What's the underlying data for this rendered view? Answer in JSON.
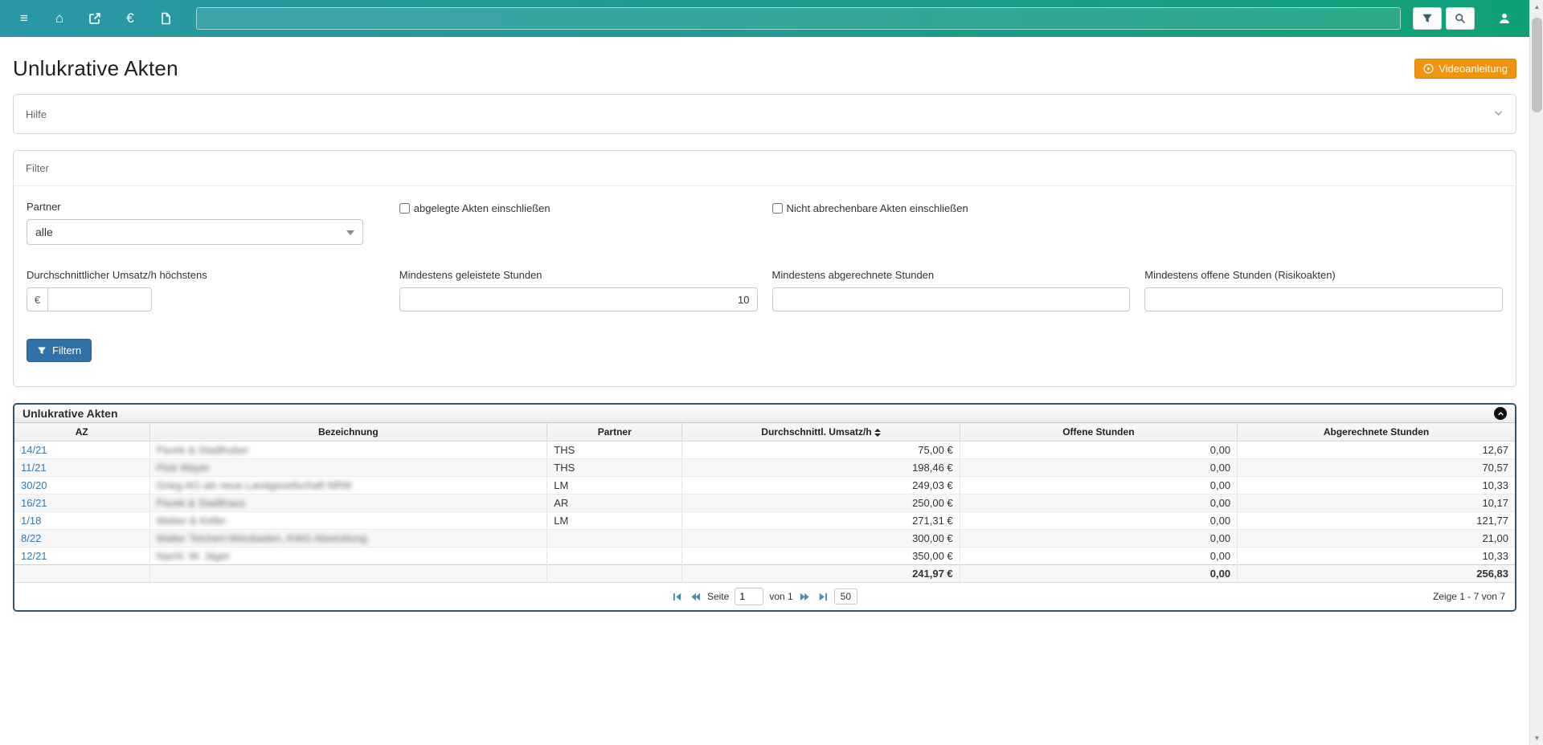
{
  "colors": {
    "navbar_start": "#2b97a6",
    "navbar_end": "#10a077",
    "accent_orange": "#f0930f",
    "accent_blue": "#3071a9",
    "link_blue": "#3079b5",
    "table_border": "#33536b"
  },
  "icons": [
    "menu-icon",
    "home-icon",
    "external-link-icon",
    "euro-icon",
    "file-icon",
    "filter-funnel-icon",
    "search-icon",
    "user-icon",
    "play-circle-icon",
    "chevron-down-icon",
    "collapse-up-icon",
    "sort-icon",
    "first-page-icon",
    "prev-page-icon",
    "next-page-icon",
    "last-page-icon",
    "scroll-up-icon",
    "scroll-down-icon"
  ],
  "navbar": {
    "menu_glyph": "≡",
    "home_glyph": "⌂",
    "euro_glyph": "€",
    "search_value": "",
    "search_placeholder": ""
  },
  "page": {
    "title": "Unlukrative Akten",
    "video_button_label": "Videoanleitung"
  },
  "help_panel": {
    "title": "Hilfe"
  },
  "filter": {
    "title": "Filter",
    "partner": {
      "label": "Partner",
      "value": "alle"
    },
    "checkboxes": [
      {
        "label": "abgelegte Akten einschließen",
        "checked": false
      },
      {
        "label": "Nicht abrechenbare Akten einschließen",
        "checked": false
      }
    ],
    "umsatz": {
      "label": "Durchschnittlicher Umsatz/h höchstens",
      "prefix": "€",
      "value": ""
    },
    "geleistet": {
      "label": "Mindestens geleistete Stunden",
      "value": "10"
    },
    "abgerechnet": {
      "label": "Mindestens abgerechnete Stunden",
      "value": ""
    },
    "offen": {
      "label": "Mindestens offene Stunden (Risikoakten)",
      "value": ""
    },
    "submit_label": "Filtern"
  },
  "table": {
    "title": "Unlukrative Akten",
    "columns": [
      "AZ",
      "Bezeichnung",
      "Partner",
      "Durchschnittl. Umsatz/h",
      "Offene Stunden",
      "Abgerechnete Stunden"
    ],
    "rows": [
      {
        "az": "14/21",
        "bezeichnung": "Pavek & Stadlhuber",
        "partner": "THS",
        "umsatz": "75,00 €",
        "offene": "0,00",
        "abgerechnet": "12,67"
      },
      {
        "az": "11/21",
        "bezeichnung": "Piotr Mayer",
        "partner": "THS",
        "umsatz": "198,46 €",
        "offene": "0,00",
        "abgerechnet": "70,57"
      },
      {
        "az": "30/20",
        "bezeichnung": "Grieg-AG als neue Landgesellschaft NRW",
        "partner": "LM",
        "umsatz": "249,03 €",
        "offene": "0,00",
        "abgerechnet": "10,33"
      },
      {
        "az": "16/21",
        "bezeichnung": "Pavek & Stadthaus",
        "partner": "AR",
        "umsatz": "250,00 €",
        "offene": "0,00",
        "abgerechnet": "10,17"
      },
      {
        "az": "1/18",
        "bezeichnung": "Weber & Keller",
        "partner": "LM",
        "umsatz": "271,31 €",
        "offene": "0,00",
        "abgerechnet": "121,77"
      },
      {
        "az": "8/22",
        "bezeichnung": "Walter Teichert-Wiesbaden, KWG Abwicklung",
        "partner": "",
        "umsatz": "300,00 €",
        "offene": "0,00",
        "abgerechnet": "21,00"
      },
      {
        "az": "12/21",
        "bezeichnung": "Nachl. W. Jäger",
        "partner": "",
        "umsatz": "350,00 €",
        "offene": "0,00",
        "abgerechnet": "10,33"
      }
    ],
    "totals": {
      "umsatz": "241,97 €",
      "offene": "0,00",
      "abgerechnet": "256,83"
    },
    "pagination": {
      "seite_label": "Seite",
      "page_value": "1",
      "von_label": "von 1",
      "pagesize": "50",
      "zeige": "Zeige 1 - 7 von 7"
    }
  }
}
